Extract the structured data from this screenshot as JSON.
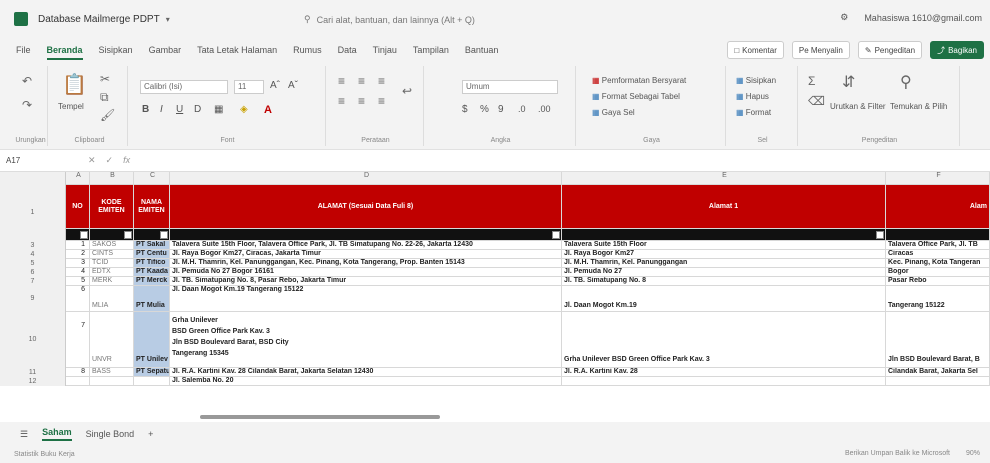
{
  "titlebar": {
    "doc_title": "Database Mailmerge PDPT",
    "search_placeholder": "Cari alat, bantuan, dan lainnya (Alt + Q)",
    "account": "Mahasiswa 1610@gmail.com"
  },
  "menu": {
    "tabs": [
      "File",
      "Beranda",
      "Sisipkan",
      "Gambar",
      "Tata Letak Halaman",
      "Rumus",
      "Data",
      "Tinjau",
      "Tampilan",
      "Bantuan"
    ],
    "active": "Beranda",
    "comments_label": "Komentar",
    "catch_up_label": "Pe Menyalin",
    "editing_label": "Pengeditan",
    "share_label": "Bagikan"
  },
  "ribbon": {
    "undo_label": "Urungkan",
    "clipboard_label": "Clipboard",
    "paste_label": "Tempel",
    "font_name": "Calibri (Isi)",
    "font_size": "11",
    "font_label": "Font",
    "alignment_label": "Perataan",
    "number_format": "Umum",
    "number_label": "Angka",
    "cond_format": "Pemformatan Bersyarat",
    "format_table": "Format Sebagai Tabel",
    "cell_styles": "Gaya Sel",
    "styles_label": "Gaya",
    "insert_label": "Sisipkan",
    "delete_label": "Hapus",
    "format_label": "Format",
    "cells_label": "Sel",
    "sort_filter": "Urutkan & Filter",
    "find_select": "Temukan & Pilih",
    "editing_group": "Pengeditan"
  },
  "formula": {
    "namebox": "A17",
    "fx": "fx"
  },
  "columns": [
    "A",
    "B",
    "C",
    "D",
    "E",
    "F"
  ],
  "header_row": {
    "no": "NO",
    "kode": "KODE EMITEN",
    "nama": "NAMA EMITEN",
    "alamat": "ALAMAT (Sesuai Data Fuli 8)",
    "alamat1": "Alamat 1",
    "alamat2": "Alam"
  },
  "rows": [
    {
      "rn": "3",
      "no": "1",
      "kode": "SAKOS",
      "nama": "PT Sakal",
      "alamat": "Talavera Suite 15th Floor, Talavera Office Park, Jl. TB Simatupang No. 22-26, Jakarta 12430",
      "a1": "Talavera Suite 15th Floor",
      "a2": "Talavera Office Park, Jl. TB"
    },
    {
      "rn": "4",
      "no": "2",
      "kode": "CINTS",
      "nama": "PT Centu",
      "alamat": "Jl. Raya Bogor Km27, Ciracas, Jakarta Timur",
      "a1": "Jl. Raya Bogor Km27",
      "a2": "Ciracas"
    },
    {
      "rn": "5",
      "no": "3",
      "kode": "TCID",
      "nama": "PT Tifico",
      "alamat": "Jl. M.H. Thamrin, Kel. Panunggangan, Kec. Pinang, Kota Tangerang, Prop. Banten 15143",
      "a1": "Jl. M.H. Thamrin, Kel. Panunggangan",
      "a2": "Kec. Pinang, Kota Tangeran"
    },
    {
      "rn": "6",
      "no": "4",
      "kode": "EDTX",
      "nama": "PT Kaada",
      "alamat": "Jl. Pemuda No 27 Bogor 16161",
      "a1": "Jl. Pemuda No 27",
      "a2": "Bogor"
    },
    {
      "rn": "7",
      "no": "5",
      "kode": "MERK",
      "nama": "PT Merck",
      "alamat": "Jl. TB. Simatupang No. 8, Pasar Rebo, Jakarta Timur",
      "a1": "Jl. TB. Simatupang No. 8",
      "a2": "Pasar Rebo"
    },
    {
      "rn": "9",
      "no": "6",
      "kode": "MLIA",
      "nama": "PT Mulia",
      "alamat": "Jl. Daan Mogot Km.19 Tangerang 15122",
      "a1": "Jl. Daan Mogot Km.19",
      "a2": "Tangerang 15122"
    },
    {
      "rn": "10",
      "no": "7",
      "kode": "UNVR",
      "nama": "PT Unilev",
      "alamat_lines": [
        "Grha Unilever",
        "BSD Green Office Park Kav. 3",
        "Jln BSD Boulevard Barat, BSD City",
        "Tangerang 15345"
      ],
      "a1": "Grha Unilever BSD Green Office Park Kav. 3",
      "a2": "Jln BSD Boulevard Barat, B"
    },
    {
      "rn": "11",
      "no": "8",
      "kode": "BASS",
      "nama": "PT Sepatu",
      "alamat": "Jl. R.A. Kartini Kav. 28 Cilandak Barat, Jakarta Selatan 12430",
      "a1": "Jl. R.A. Kartini Kav. 28",
      "a2": "Cilandak Barat, Jakarta Sel"
    },
    {
      "rn": "12",
      "no": "",
      "kode": "",
      "nama": "",
      "alamat": "Jl. Salemba No. 20",
      "a1": "",
      "a2": ""
    }
  ],
  "sheets": [
    "Saham",
    "Single Bond"
  ],
  "active_sheet": "Saham",
  "status": {
    "left": "Statistik Buku Kerja",
    "feedback": "Berikan Umpan Balik ke Microsoft",
    "zoom": "90%"
  }
}
